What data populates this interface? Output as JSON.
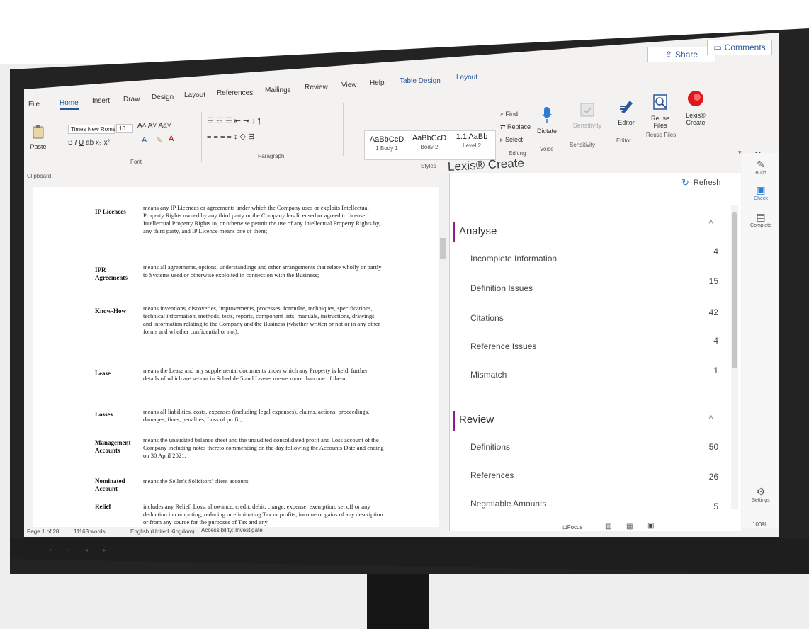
{
  "window": {
    "share_label": "Share",
    "comments_label": "Comments"
  },
  "tabs": [
    "File",
    "Home",
    "Insert",
    "Draw",
    "Design",
    "Layout",
    "References",
    "Mailings",
    "Review",
    "View",
    "Help",
    "Table Design",
    "Layout"
  ],
  "ribbon": {
    "clipboard": {
      "paste": "Paste",
      "group": "Clipboard"
    },
    "font": {
      "family": "Times New Roma",
      "size": "10",
      "group": "Font"
    },
    "paragraph": {
      "group": "Paragraph"
    },
    "styles": {
      "group": "Styles",
      "items": [
        {
          "sample": "AaBbCcD",
          "name": "1 Body 1"
        },
        {
          "sample": "AaBbCcD",
          "name": "Body 2"
        },
        {
          "sample": "1.1 AaBb",
          "name": "Level 2"
        }
      ]
    },
    "editing": {
      "find": "Find",
      "replace": "Replace",
      "select": "Select",
      "group": "Editing"
    },
    "voice": {
      "dictate": "Dictate",
      "group": "Voice"
    },
    "sensitivity": {
      "label": "Sensitivity",
      "group": "Sensitivity"
    },
    "editor": {
      "label": "Editor",
      "group": "Editor"
    },
    "reuse": {
      "label1": "Reuse",
      "label2": "Files",
      "group": "Reuse Files"
    },
    "lexis": {
      "label1": "Lexis®",
      "label2": "Create"
    }
  },
  "document": {
    "entries": [
      {
        "term": "IP Licences",
        "definition": "means any IP Licences or agreements under which the Company uses or exploits Intellectual Property Rights owned by any third party or the Company has licensed or agreed to license Intellectual Property Rights to, or otherwise permit the use of any Intellectual Property Rights by, any third party, and IP Licence means one of them;"
      },
      {
        "term": "IPR Agreements",
        "definition": "means all agreements, options, understandings and other arrangements that relate wholly or partly to Systems used or otherwise exploited in connection with the Business;"
      },
      {
        "term": "Know-How",
        "definition": "means inventions, discoveries, improvements, processes, formulae, techniques, specifications, technical information, methods, tests, reports, component lists, manuals, instructions, drawings and information relating to the Company and the Business (whether written or not or in any other forms and whether confidential or not);"
      },
      {
        "term": "Lease",
        "definition": "means the Lease and any supplemental documents under which any Property is held, further details of which are set out in Schedule 5 and Leases means more than one of them;"
      },
      {
        "term": "Losses",
        "definition": "means all liabilities, costs, expenses (including legal expenses), claims, actions, proceedings, damages, fines, penalties, Loss of profit;"
      },
      {
        "term": "Management Accounts",
        "definition": "means the unaudited balance sheet and the unaudited consolidated profit and Loss account of the Company including notes thereto commencing on the day following the Accounts Date and ending on 30 April 2021;"
      },
      {
        "term": "Nominated Account",
        "definition": "means the Seller's Solicitors' client account;"
      },
      {
        "term": "Relief",
        "definition": "includes any Relief, Loss, allowance, credit, debit, charge, expense, exemption, set off or any deduction in computing, reducing or eliminating Tax or profits, income or gains of any description or from any source for the purposes of Tax and any"
      }
    ]
  },
  "pane": {
    "title": "Lexis® Create",
    "refresh": "Refresh",
    "sections": [
      {
        "title": "Analyse",
        "rows": [
          {
            "label": "Incomplete Information",
            "count": "4"
          },
          {
            "label": "Definition Issues",
            "count": "15"
          },
          {
            "label": "Citations",
            "count": "42"
          },
          {
            "label": "Reference Issues",
            "count": "4"
          },
          {
            "label": "Mismatch",
            "count": "1"
          }
        ]
      },
      {
        "title": "Review",
        "rows": [
          {
            "label": "Definitions",
            "count": "50"
          },
          {
            "label": "References",
            "count": "26"
          },
          {
            "label": "Negotiable Amounts",
            "count": "5"
          }
        ]
      }
    ]
  },
  "rail": {
    "build": "Build",
    "check": "Check",
    "complete": "Complete",
    "settings": "Settings"
  },
  "status": {
    "page": "Page 1 of 28",
    "words": "11163 words",
    "language": "English (United Kingdom)",
    "accessibility": "Accessibility: Investigate",
    "focus": "Focus",
    "zoom": "100%"
  },
  "colors": {
    "accent": "#2b579a",
    "lexis": "#8b1a8b",
    "frame": "#232323"
  }
}
